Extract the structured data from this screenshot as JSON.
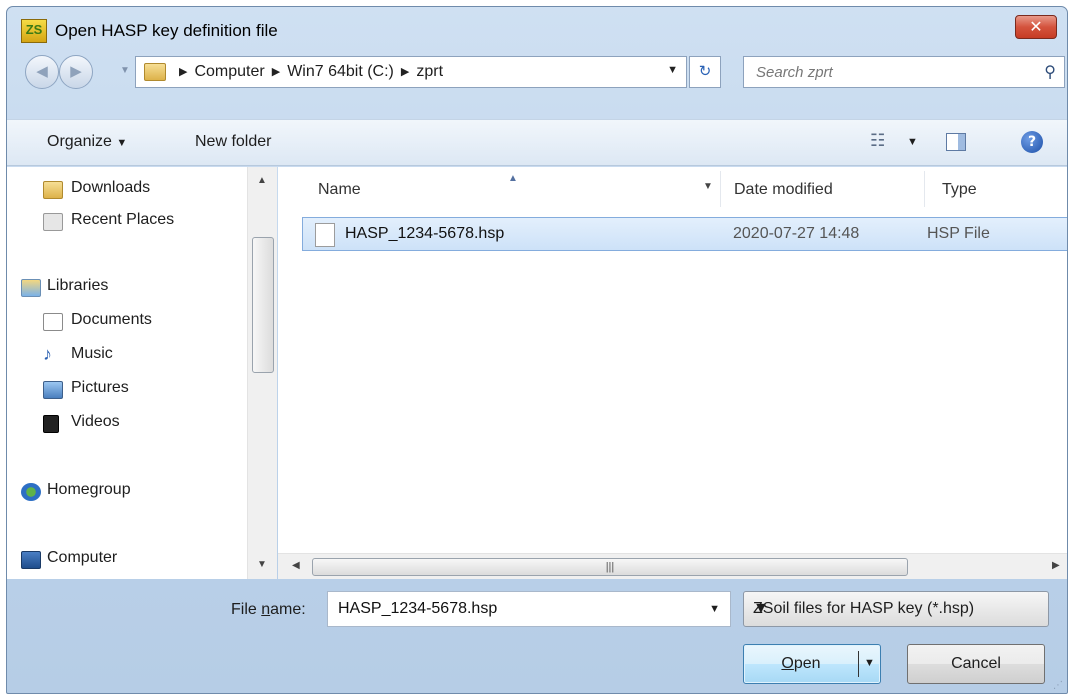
{
  "window": {
    "title": "Open HASP key definition file",
    "close_label": "✕",
    "app_icon_text": "ZS"
  },
  "address_bar": {
    "crumbs": [
      "Computer",
      "Win7 64bit (C:)",
      "zprt"
    ],
    "search_placeholder": "Search zprt"
  },
  "toolbar": {
    "organize_label": "Organize",
    "new_folder_label": "New folder"
  },
  "navigation": {
    "items": [
      {
        "label": "Downloads",
        "icon": "downloads-folder-icon"
      },
      {
        "label": "Recent Places",
        "icon": "recent-places-icon"
      },
      {
        "label": "Libraries",
        "icon": "libraries-icon"
      },
      {
        "label": "Documents",
        "icon": "documents-icon"
      },
      {
        "label": "Music",
        "icon": "music-icon"
      },
      {
        "label": "Pictures",
        "icon": "pictures-icon"
      },
      {
        "label": "Videos",
        "icon": "videos-icon"
      },
      {
        "label": "Homegroup",
        "icon": "homegroup-icon"
      },
      {
        "label": "Computer",
        "icon": "computer-icon"
      }
    ]
  },
  "file_list": {
    "columns": [
      "Name",
      "Date modified",
      "Type"
    ],
    "rows": [
      {
        "name": "HASP_1234-5678.hsp",
        "date_modified": "2020-07-27 14:48",
        "type": "HSP File"
      }
    ]
  },
  "footer": {
    "file_name_label_prefix": "File ",
    "file_name_label_accel": "n",
    "file_name_label_suffix": "ame:",
    "file_name_value": "HASP_1234-5678.hsp",
    "file_type_value": "ZSoil files for HASP key (*.hsp)",
    "open_label_accel": "O",
    "open_label_rest": "pen",
    "cancel_label": "Cancel"
  },
  "colors": {
    "selection_bg": "#cde2f8",
    "selection_border": "#84acdd",
    "frame": "#bcd2ea",
    "close_button": "#c63c25",
    "open_button": "#a7d9f5"
  }
}
